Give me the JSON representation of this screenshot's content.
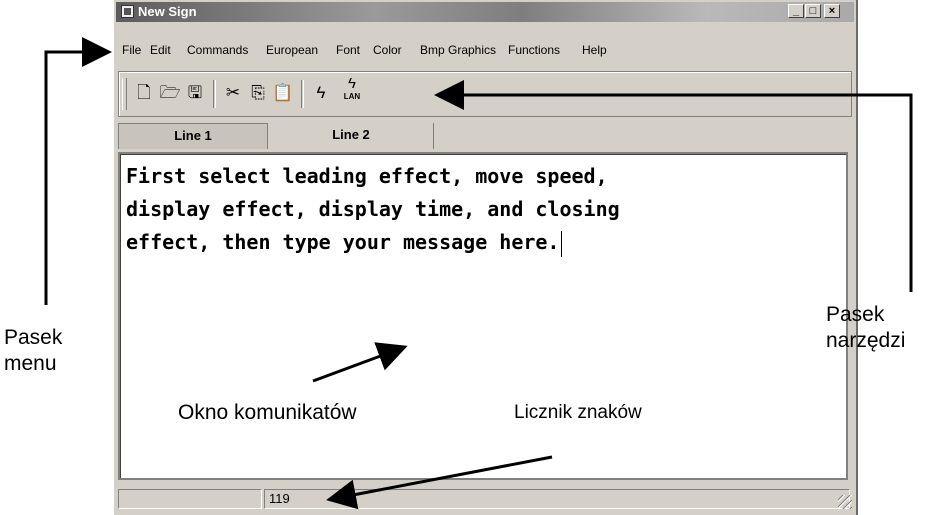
{
  "window": {
    "title": "New Sign",
    "controls": [
      "_",
      "□",
      "×"
    ]
  },
  "menu": [
    "File",
    "Edit",
    "Commands",
    "European",
    "Font",
    "Color",
    "Bmp Graphics",
    "Functions",
    "Help"
  ],
  "toolbar": {
    "icons": [
      "new-file-icon",
      "open-folder-icon",
      "save-icon",
      "cut-icon",
      "copy-icon",
      "paste-icon",
      "send-icon",
      "send-lan-icon"
    ],
    "lan_label": "LAN"
  },
  "tabs": [
    {
      "label": "Line 1",
      "selected": true
    },
    {
      "label": "Line 2",
      "selected": false
    }
  ],
  "editor": {
    "lines": [
      "First select leading effect, move speed,",
      "display effect, display time, and closing",
      "effect, then type your message here."
    ]
  },
  "statusbar": {
    "char_count": "119"
  },
  "annotations": {
    "menu_bar": [
      "Pasek",
      "menu"
    ],
    "toolbar": [
      "Pasek",
      "narzędzi"
    ],
    "message_window": "Okno komunikatów",
    "char_counter": "Licznik znaków"
  }
}
